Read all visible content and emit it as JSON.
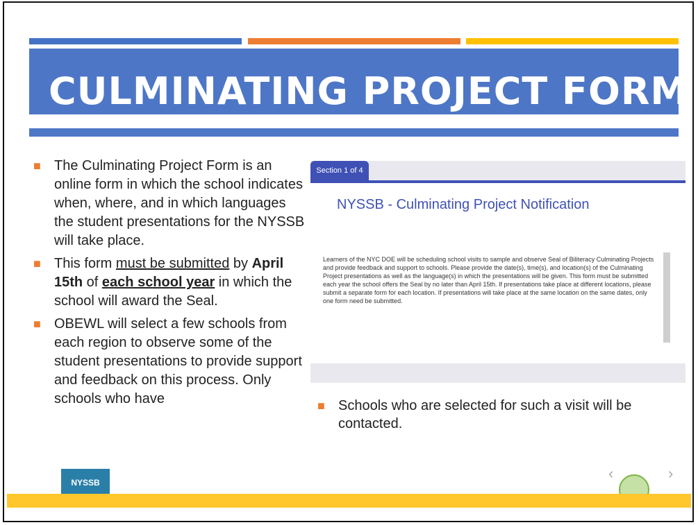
{
  "slide": {
    "title": "CULMINATING PROJECT FORM"
  },
  "left_bullets": [
    {
      "parts": [
        {
          "text": "The Culminating Project Form is an online form in which the school indicates when, where, and in which languages the student presentations for the NYSSB will take place.",
          "style": ""
        }
      ]
    },
    {
      "parts": [
        {
          "text": "This form ",
          "style": ""
        },
        {
          "text": "must be submitted",
          "style": "underline"
        },
        {
          "text": " by ",
          "style": ""
        },
        {
          "text": "April 15th",
          "style": "bold"
        },
        {
          "text": " of ",
          "style": ""
        },
        {
          "text": "each school year",
          "style": "bold underline"
        },
        {
          "text": " in which the school will award the Seal.",
          "style": ""
        }
      ]
    },
    {
      "parts": [
        {
          "text": "OBEWL will select a few schools from each region to observe some of the student presentations to provide support and feedback on this process. Only schools who have ",
          "style": ""
        }
      ]
    }
  ],
  "form_screenshot": {
    "section_label": "Section 1 of 4",
    "title": "NYSSB - Culminating Project Notification",
    "body": "Learners of the NYC DOE will be scheduling school visits to sample and observe Seal of Biliteracy Culminating Projects and provide feedback and support to schools. Please provide the date(s), time(s), and location(s) of the Culminating Project presentations as well as the language(s) in which the presentations will be given. This form must be submitted each year the school offers the Seal by no later than April 15th. If presentations take place at different locations, please submit a separate form for each location. If presentations will take place at the same location on the same dates, only one form need be submitted."
  },
  "right_bullet": "Schools who are selected for such a visit will be contacted.",
  "footer": {
    "logo_text": "NYSSB"
  },
  "colors": {
    "stripe_blue": "#4472c4",
    "stripe_orange": "#ed7d31",
    "stripe_gold": "#ffc000",
    "title_band": "#4e76c6",
    "form_accent": "#3f51b5"
  }
}
